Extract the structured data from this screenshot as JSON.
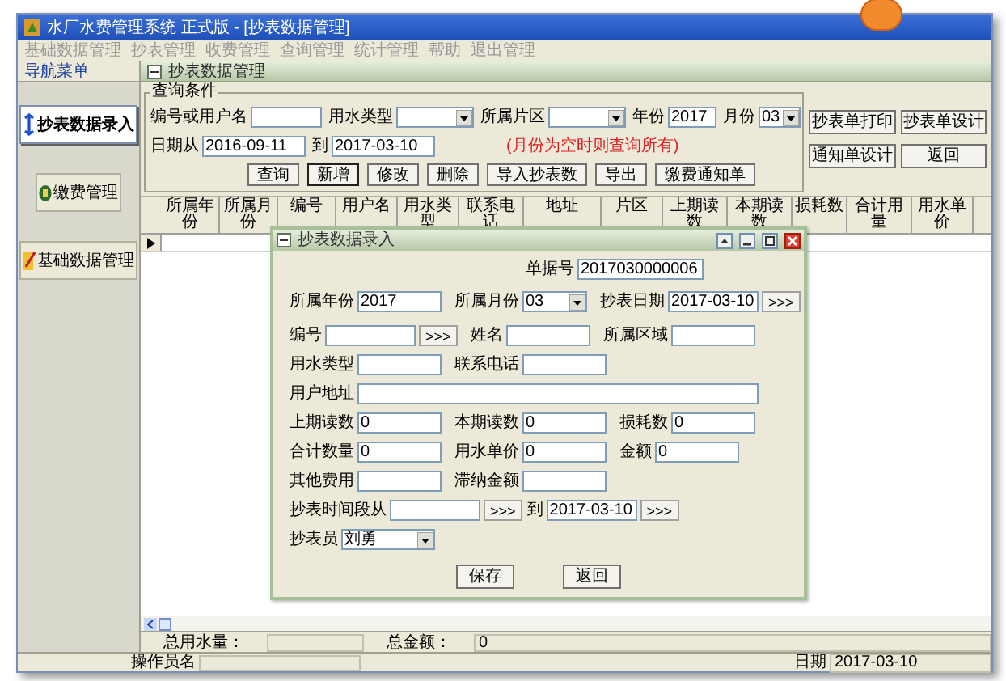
{
  "window": {
    "title": "水厂水费管理系统 正式版  - [抄表数据管理]"
  },
  "menu": [
    "基础数据管理",
    "抄表管理",
    "收费管理",
    "查询管理",
    "统计管理",
    "帮助",
    "退出管理"
  ],
  "nav": {
    "title": "导航菜单",
    "items": [
      {
        "label": "抄表数据录入",
        "selected": true,
        "kind": "meter"
      },
      {
        "label": "缴费管理",
        "selected": false,
        "kind": "money"
      },
      {
        "label": "基础数据管理",
        "selected": false,
        "kind": "edit"
      }
    ]
  },
  "child_window": {
    "title": "抄表数据管理"
  },
  "query": {
    "title": "查询条件",
    "row_1": [
      {
        "kind": "input",
        "label": "编号或用户名"
      },
      {
        "kind": "select",
        "label": "用水类型"
      },
      {
        "kind": "select",
        "label": "所属片区"
      },
      {
        "kind": "year",
        "label": "年份",
        "value": "2017"
      },
      {
        "kind": "month",
        "label": "月份",
        "value": "03"
      }
    ],
    "note": "(月份为空时则查询所有)",
    "row_2": [
      {
        "kind": "date",
        "label": "日期从",
        "value": "2016-09-11"
      },
      {
        "kind": "date",
        "label": "到",
        "value": "2017-03-10"
      }
    ],
    "buttons": [
      "查询",
      "新增",
      "修改",
      "删除",
      "导入抄表数",
      "导出",
      "缴费通知单"
    ],
    "side_buttons": [
      "抄表单打印",
      "抄表单设计",
      "通知单设计",
      "返回"
    ]
  },
  "table": {
    "columns": [
      "所属年份",
      "所属月份",
      "编号",
      "用户名",
      "用水类型",
      "联系电话",
      "地址",
      "片区",
      "上期读数",
      "本期读数",
      "损耗数",
      "合计用量",
      "用水单价"
    ]
  },
  "totals": [
    {
      "label": "总用水量："
    },
    {
      "label": "总金额：",
      "value": "0"
    }
  ],
  "status_bar": {
    "operator_label": "操作员名",
    "date_label": "日期",
    "date": "2017-03-10"
  },
  "dialog": {
    "title": "抄表数据录入",
    "receipt": {
      "label": "单据号",
      "value": "2017030000006"
    },
    "rows": [
      [
        {
          "kind": "input",
          "label": "所属年份",
          "value": "2017"
        },
        {
          "kind": "select",
          "label": "所属月份",
          "value": "03"
        },
        {
          "kind": "picker",
          "label": "抄表日期",
          "value": "2017-03-10",
          "button": ">>>"
        }
      ],
      [
        {
          "kind": "picker",
          "label": "编号",
          "button": ">>>"
        },
        {
          "kind": "input",
          "label": "姓名"
        },
        {
          "kind": "input",
          "label": "所属区域"
        }
      ],
      [
        {
          "kind": "input",
          "label": "用水类型"
        },
        {
          "kind": "input",
          "label": "联系电话"
        }
      ],
      [
        {
          "kind": "input",
          "label": "用户地址"
        }
      ],
      [
        {
          "kind": "input",
          "label": "上期读数",
          "value": "0"
        },
        {
          "kind": "input",
          "label": "本期读数",
          "value": "0"
        },
        {
          "kind": "input",
          "label": "损耗数",
          "value": "0"
        }
      ],
      [
        {
          "kind": "input",
          "label": "合计数量",
          "value": "0"
        },
        {
          "kind": "input",
          "label": "用水单价",
          "value": "0"
        },
        {
          "kind": "input",
          "label": "金额",
          "value": "0"
        }
      ],
      [
        {
          "kind": "input",
          "label": "其他费用"
        },
        {
          "kind": "input",
          "label": "滞纳金额"
        }
      ],
      [
        {
          "kind": "picker",
          "label": "抄表时间段从",
          "button": ">>>"
        },
        {
          "kind": "picker",
          "label": "到",
          "value": "2017-03-10",
          "button": ">>>"
        }
      ],
      [
        {
          "kind": "select",
          "label": "抄表员",
          "value": "刘勇"
        }
      ]
    ],
    "buttons": [
      "保存",
      "返回"
    ]
  }
}
